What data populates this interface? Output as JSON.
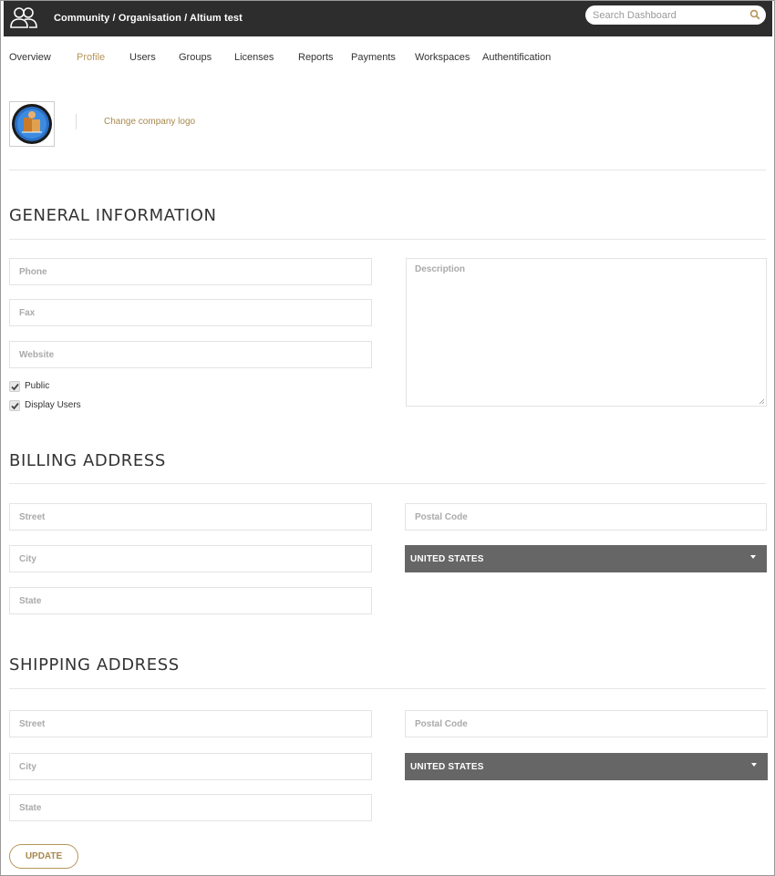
{
  "header": {
    "breadcrumb": "Community / Organisation / Altium test",
    "search_placeholder": "Search Dashboard"
  },
  "tabs": [
    {
      "label": "Overview",
      "active": false
    },
    {
      "label": "Profile",
      "active": true
    },
    {
      "label": "Users",
      "active": false
    },
    {
      "label": "Groups",
      "active": false
    },
    {
      "label": "Licenses",
      "active": false
    },
    {
      "label": "Reports",
      "active": false
    },
    {
      "label": "Payments",
      "active": false
    },
    {
      "label": "Workspaces",
      "active": false
    },
    {
      "label": "Authentification",
      "active": false
    }
  ],
  "company": {
    "change_logo_label": "Change company logo"
  },
  "general": {
    "title": "GENERAL INFORMATION",
    "phone_placeholder": "Phone",
    "fax_placeholder": "Fax",
    "website_placeholder": "Website",
    "description_placeholder": "Description",
    "public_label": "Public",
    "public_checked": true,
    "display_users_label": "Display Users",
    "display_users_checked": true
  },
  "billing": {
    "title": "BILLING ADDRESS",
    "street_placeholder": "Street",
    "city_placeholder": "City",
    "state_placeholder": "State",
    "postal_placeholder": "Postal Code",
    "country_value": "UNITED STATES"
  },
  "shipping": {
    "title": "SHIPPING ADDRESS",
    "street_placeholder": "Street",
    "city_placeholder": "City",
    "state_placeholder": "State",
    "postal_placeholder": "Postal Code",
    "country_value": "UNITED STATES"
  },
  "actions": {
    "update_label": "UPDATE"
  },
  "colors": {
    "topbar": "#2d2d2d",
    "accent": "#b5965b",
    "select_bg": "#666666"
  }
}
